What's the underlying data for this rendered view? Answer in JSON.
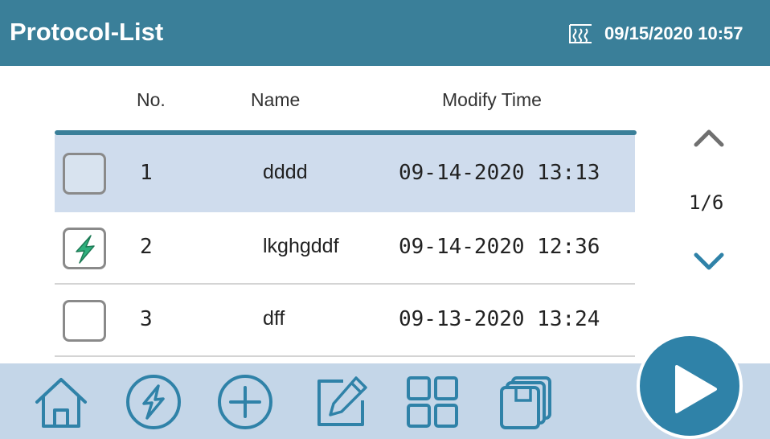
{
  "header": {
    "title": "Protocol-List",
    "heater_icon": "heater-icon",
    "datetime": "09/15/2020 10:57"
  },
  "table": {
    "columns": [
      "No.",
      "Name",
      "Modify  Time"
    ],
    "rows": [
      {
        "no": "1",
        "name": "dddd",
        "modify_time": "09-14-2020 13:13",
        "selected": true,
        "icon": ""
      },
      {
        "no": "2",
        "name": "lkghgddf",
        "modify_time": "09-14-2020 12:36",
        "selected": false,
        "icon": "lightning-icon"
      },
      {
        "no": "3",
        "name": "dff",
        "modify_time": "09-13-2020 13:24",
        "selected": false,
        "icon": ""
      }
    ]
  },
  "pager": {
    "page_text": "1/6",
    "up_icon": "chevron-up-icon",
    "down_icon": "chevron-down-icon"
  },
  "toolbar": {
    "buttons": [
      "home-icon",
      "lightning-icon",
      "add-icon",
      "edit-icon",
      "grid-icon",
      "copy-icon"
    ],
    "run_icon": "play-icon"
  },
  "colors": {
    "header": "#3a7f99",
    "selected_row": "#cfdced",
    "toolbar": "#c4d6e8",
    "accent": "#2f82a8",
    "lightning": "#2fb07d"
  }
}
